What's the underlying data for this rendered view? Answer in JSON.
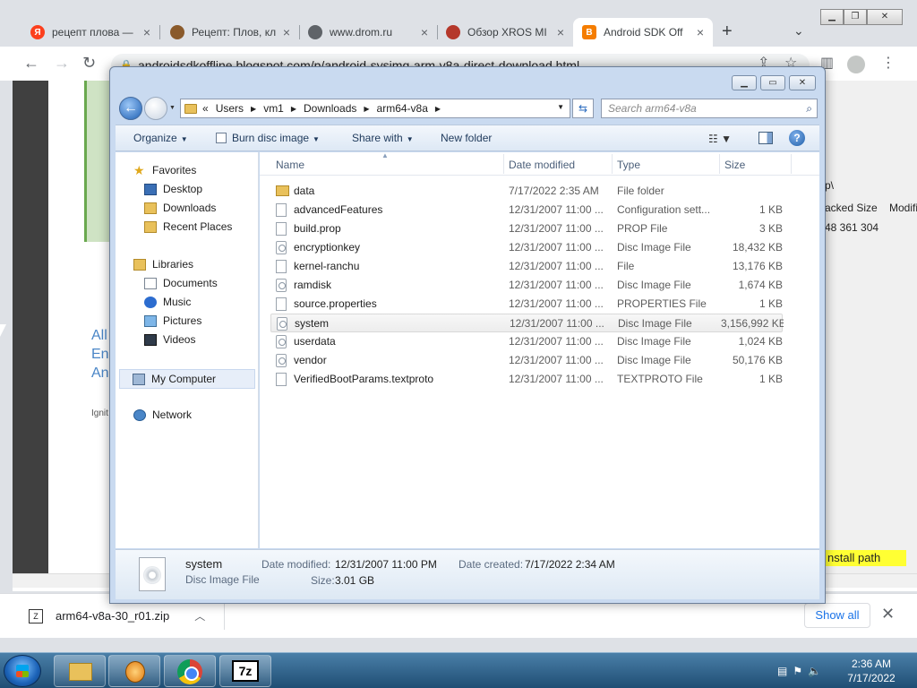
{
  "browser": {
    "tabs": [
      {
        "title": "рецепт плова —",
        "favicon": "yandex-icon",
        "color": "#fc3f1d"
      },
      {
        "title": "Рецепт: Плов, кл",
        "favicon": "pan-icon",
        "color": "#8a5a2b"
      },
      {
        "title": "www.drom.ru",
        "favicon": "globe-icon",
        "color": "#5f6368"
      },
      {
        "title": "Обзор XROS MI",
        "favicon": "xros-icon",
        "color": "#b5382b"
      },
      {
        "title": "Android SDK Off",
        "favicon": "blogger-icon",
        "color": "#f57d00"
      }
    ],
    "url": "androidsdkoffline.blogspot.com/p/android-sysimg-arm-v8a-direct-download.html",
    "new_tab": "+",
    "download": {
      "filename": "arm64-v8a-30_r01.zip",
      "show_all": "Show all"
    }
  },
  "page_bg": {
    "lines": [
      "All",
      "En",
      "An"
    ],
    "small": "Ignit",
    "right_panel": {
      "path": "p\\",
      "col1": "acked Size",
      "col2": "Modifie",
      "value": "48 361 304",
      "install": "nstall path"
    }
  },
  "explorer": {
    "path": [
      "Users",
      "vm1",
      "Downloads",
      "arm64-v8a"
    ],
    "crumb_prefix": "«",
    "search_placeholder": "Search arm64-v8a",
    "commands": {
      "organize": "Organize",
      "burn": "Burn disc image",
      "share": "Share with",
      "new_folder": "New folder"
    },
    "nav": {
      "favorites": "Favorites",
      "desktop": "Desktop",
      "downloads": "Downloads",
      "recent": "Recent Places",
      "libraries": "Libraries",
      "documents": "Documents",
      "music": "Music",
      "pictures": "Pictures",
      "videos": "Videos",
      "computer": "My Computer",
      "network": "Network"
    },
    "columns": {
      "name": "Name",
      "date": "Date modified",
      "type": "Type",
      "size": "Size"
    },
    "files": [
      {
        "name": "data",
        "date": "7/17/2022 2:35 AM",
        "type": "File folder",
        "size": "",
        "icon": "folder"
      },
      {
        "name": "advancedFeatures",
        "date": "12/31/2007 11:00 ...",
        "type": "Configuration sett...",
        "size": "1 KB",
        "icon": "file"
      },
      {
        "name": "build.prop",
        "date": "12/31/2007 11:00 ...",
        "type": "PROP File",
        "size": "3 KB",
        "icon": "file"
      },
      {
        "name": "encryptionkey",
        "date": "12/31/2007 11:00 ...",
        "type": "Disc Image File",
        "size": "18,432 KB",
        "icon": "disc"
      },
      {
        "name": "kernel-ranchu",
        "date": "12/31/2007 11:00 ...",
        "type": "File",
        "size": "13,176 KB",
        "icon": "file"
      },
      {
        "name": "ramdisk",
        "date": "12/31/2007 11:00 ...",
        "type": "Disc Image File",
        "size": "1,674 KB",
        "icon": "disc"
      },
      {
        "name": "source.properties",
        "date": "12/31/2007 11:00 ...",
        "type": "PROPERTIES File",
        "size": "1 KB",
        "icon": "file"
      },
      {
        "name": "system",
        "date": "12/31/2007 11:00 ...",
        "type": "Disc Image File",
        "size": "3,156,992 KB",
        "icon": "disc",
        "selected": true
      },
      {
        "name": "userdata",
        "date": "12/31/2007 11:00 ...",
        "type": "Disc Image File",
        "size": "1,024 KB",
        "icon": "disc"
      },
      {
        "name": "vendor",
        "date": "12/31/2007 11:00 ...",
        "type": "Disc Image File",
        "size": "50,176 KB",
        "icon": "disc"
      },
      {
        "name": "VerifiedBootParams.textproto",
        "date": "12/31/2007 11:00 ...",
        "type": "TEXTPROTO File",
        "size": "1 KB",
        "icon": "file"
      }
    ],
    "details": {
      "name": "system",
      "type": "Disc Image File",
      "date_modified_label": "Date modified:",
      "date_modified": "12/31/2007 11:00 PM",
      "date_created_label": "Date created:",
      "date_created": "7/17/2022 2:34 AM",
      "size_label": "Size:",
      "size": "3.01 GB"
    }
  },
  "taskbar": {
    "time": "2:36 AM",
    "date": "7/17/2022",
    "sevenzip": "7z"
  },
  "colors": {
    "accent": "#1a73e8",
    "explorer_frame": "#c9daf0",
    "taskbar": "#1f4e74"
  }
}
